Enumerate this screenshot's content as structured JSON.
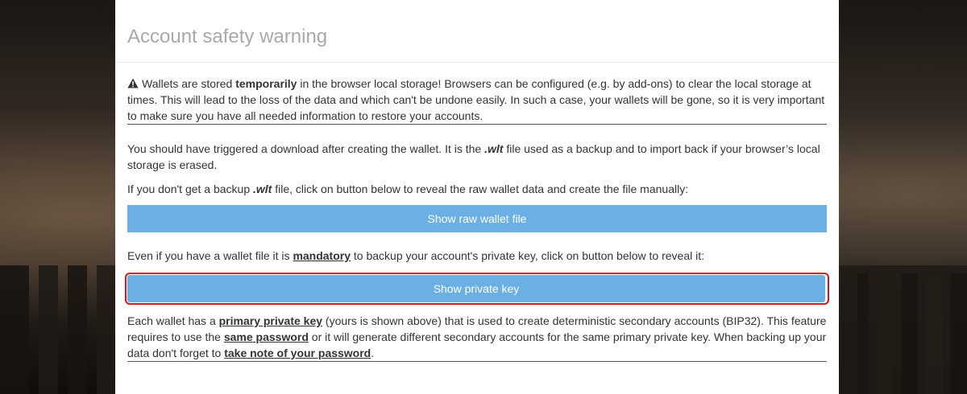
{
  "modal": {
    "title": "Account safety warning",
    "warning": {
      "icon": "warning-triangle-icon",
      "t1": "Wallets are stored ",
      "bold": "temporarily",
      "t2": " in the browser local storage! Browsers can be configured (e.g. by add-ons) to clear the local storage at times. This will lead to the loss of the data and which can't be undone easily. In such a case, your wallets will be gone, so it is very important to make sure you have all needed information to restore your accounts."
    },
    "download": {
      "t1": "You should have triggered a download after creating the wallet. It is the ",
      "ext": ".wlt",
      "t2": " file used as a backup and to import back if your browser’s local storage is erased."
    },
    "nobackup": {
      "t1": "If you don't get a backup ",
      "ext": ".wlt",
      "t2": " file, click on button below to reveal the raw wallet data and create the file manually:"
    },
    "show_raw_button": "Show raw wallet file",
    "mandatory": {
      "t1": "Even if you have a wallet file it is ",
      "link": "mandatory",
      "t2": " to backup your account's private key, click on button below to reveal it:"
    },
    "show_key_button": "Show private key",
    "primary": {
      "t1": "Each wallet has a ",
      "link1": "primary private key",
      "t2": " (yours is shown above) that is used to create deterministic secondary accounts (BIP32). This feature requires to use the ",
      "link2": "same password",
      "t3": " or it will generate different secondary accounts for the same primary private key. When backing up your data don't forget to ",
      "link3": "take note of your password",
      "t4": "."
    }
  },
  "colors": {
    "button": "#6ab0e4",
    "highlight": "#d9141c",
    "title": "#a9a9a9"
  }
}
